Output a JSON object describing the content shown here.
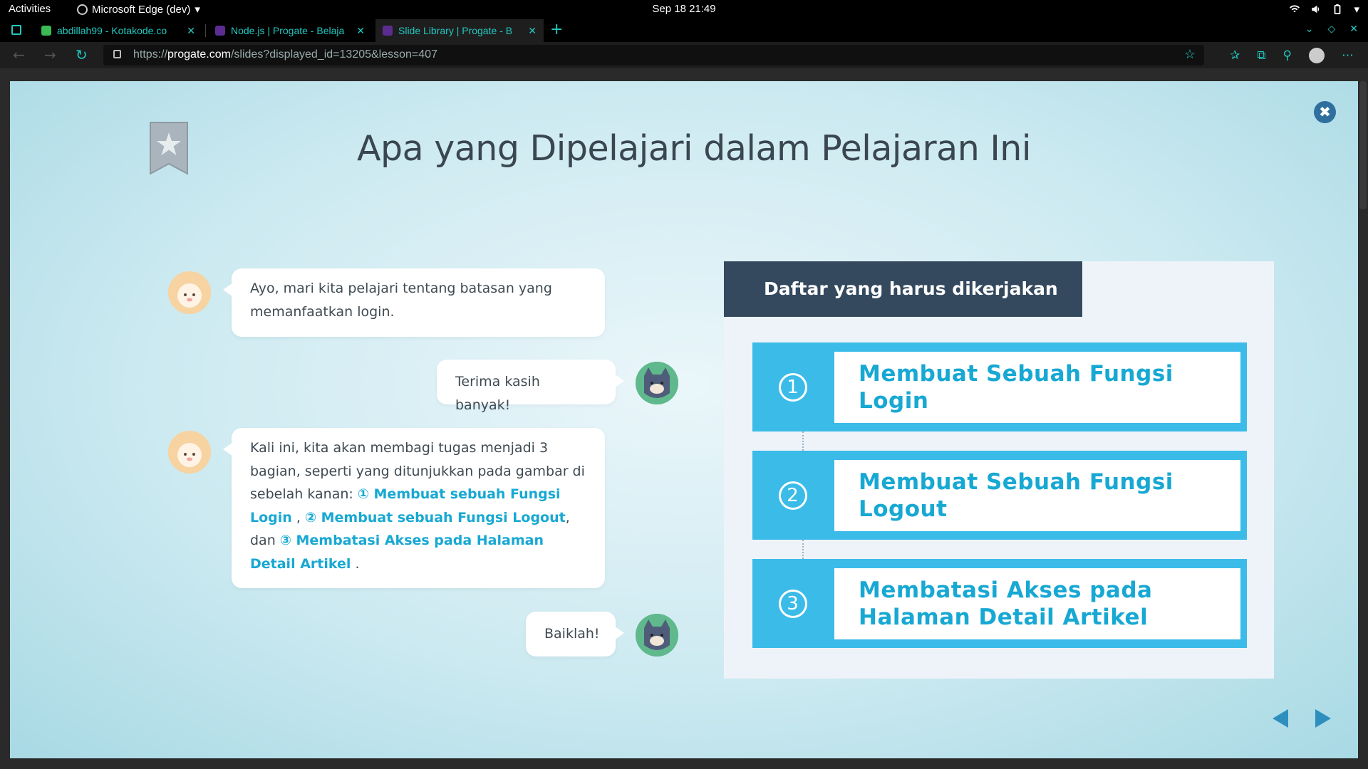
{
  "os_bar": {
    "activities": "Activities",
    "app_name": "Microsoft Edge (dev)",
    "clock": "Sep 18  21:49"
  },
  "browser": {
    "tabs": [
      {
        "title": "abdillah99 - Kotakode.co",
        "favicon_color": "#3cba54"
      },
      {
        "title": "Node.js | Progate - Belaja",
        "favicon_color": "#5c2d91"
      },
      {
        "title": "Slide Library | Progate - B",
        "favicon_color": "#5c2d91"
      }
    ],
    "url_prefix": "https://",
    "url_host": "progate.com",
    "url_rest": "/slides?displayed_id=13205&lesson=407"
  },
  "slide": {
    "title": "Apa yang Dipelajari dalam Pelajaran Ini",
    "close_glyph": "✖",
    "messages": {
      "m1": "Ayo, mari kita pelajari tentang batasan yang memanfaatkan login.",
      "m2": "Terima kasih banyak!",
      "m3_a": "Kali ini, kita akan membagi tugas menjadi 3 bagian, seperti yang ditunjukkan pada gambar di sebelah kanan: ",
      "m3_h1": "① Membuat sebuah Fungsi Login",
      "m3_b": " , ",
      "m3_h2": "② Membuat sebuah Fungsi Logout",
      "m3_c": ", dan ",
      "m3_h3": "③ Membatasi Akses pada Halaman Detail Artikel",
      "m3_d": " .",
      "m4": "Baiklah!"
    },
    "panel": {
      "heading": "Daftar yang harus dikerjakan",
      "tasks": [
        {
          "num": "1",
          "label": "Membuat Sebuah Fungsi Login"
        },
        {
          "num": "2",
          "label": "Membuat Sebuah Fungsi Logout"
        },
        {
          "num": "3",
          "label": "Membatasi Akses pada Halaman Detail Artikel"
        }
      ]
    }
  },
  "colors": {
    "accent": "#17a8d3",
    "task_bg": "#3bbbe8",
    "panel_head": "#34495e",
    "tab_text": "#22c8c0"
  }
}
